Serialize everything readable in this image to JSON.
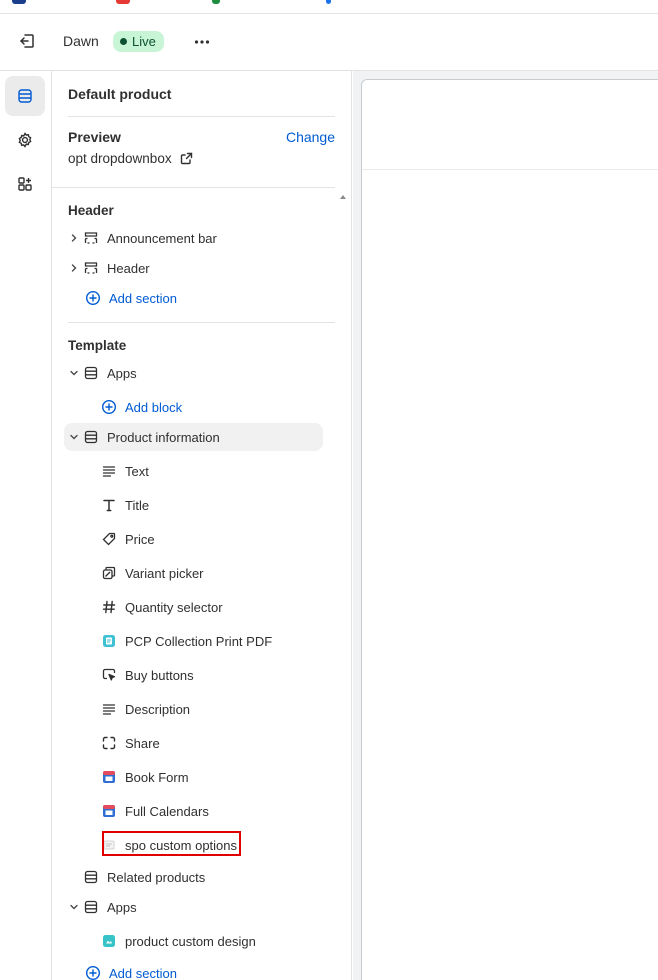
{
  "colors": {
    "accent": "#005bd3",
    "live_badge_bg": "#c8f5d5",
    "live_text": "#0c5132",
    "highlight": "#e00000"
  },
  "topbar": {
    "exit_icon": "exit-icon",
    "theme_name": "Dawn",
    "status_label": "Live",
    "more_icon": "more-horizontal-icon"
  },
  "rail": {
    "items": [
      {
        "icon": "sections-icon",
        "active": true
      },
      {
        "icon": "settings-gear-icon",
        "active": false
      },
      {
        "icon": "apps-icon",
        "active": false
      }
    ]
  },
  "panel": {
    "title": "Default product",
    "preview": {
      "label": "Preview",
      "change": "Change",
      "product": "opt dropdownbox",
      "external_icon": "external-link-icon"
    },
    "header_group": {
      "label": "Header",
      "sections": [
        {
          "label": "Announcement bar",
          "icon": "section-dashed-icon"
        },
        {
          "label": "Header",
          "icon": "section-dashed-icon"
        }
      ],
      "add_section": "Add section"
    },
    "template_group": {
      "label": "Template",
      "apps_top": {
        "label": "Apps",
        "add_block": "Add block"
      },
      "product_information": {
        "label": "Product information",
        "blocks": [
          {
            "label": "Text",
            "icon": "text-icon"
          },
          {
            "label": "Title",
            "icon": "title-icon"
          },
          {
            "label": "Price",
            "icon": "price-tag-icon"
          },
          {
            "label": "Variant picker",
            "icon": "variant-icon"
          },
          {
            "label": "Quantity selector",
            "icon": "hash-icon"
          },
          {
            "label": "PCP Collection Print PDF",
            "icon": "app-pcp-icon"
          },
          {
            "label": "Buy buttons",
            "icon": "buy-buttons-icon"
          },
          {
            "label": "Description",
            "icon": "text-icon"
          },
          {
            "label": "Share",
            "icon": "share-icon"
          },
          {
            "label": "Book Form",
            "icon": "app-book-form-icon"
          },
          {
            "label": "Full Calendars",
            "icon": "app-calendar-icon"
          },
          {
            "label": "spo custom options",
            "icon": "app-spo-icon"
          }
        ]
      },
      "related_products": "Related products",
      "apps_bottom": {
        "label": "Apps",
        "block": "product custom design"
      },
      "add_section": "Add section"
    }
  }
}
